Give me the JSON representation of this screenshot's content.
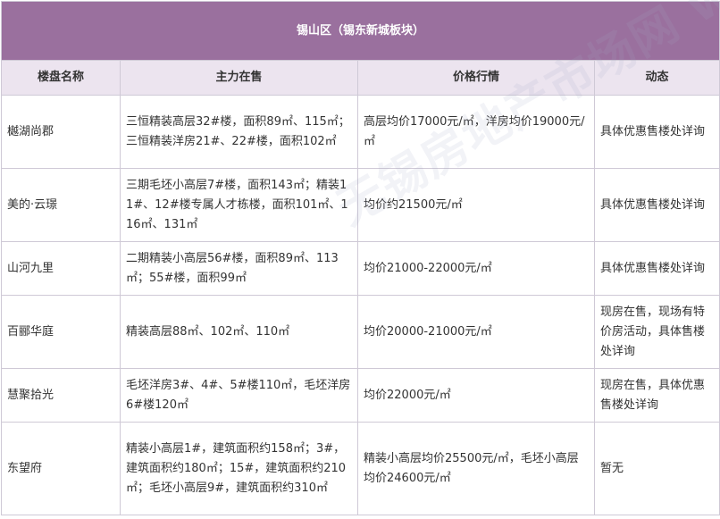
{
  "table": {
    "title": "锡山区（锡东新城板块）",
    "headers": [
      "楼盘名称",
      "主力在售",
      "价格行情",
      "动态"
    ],
    "rows": [
      {
        "name": "樾湖尚郡",
        "main_sale": "三恒精装高层32#楼，面积89㎡、115㎡；三恒精装洋房21#、22#楼，面积102㎡",
        "price": "高层均价17000元/㎡，洋房均价19000元/㎡",
        "status": "具体优惠售楼处详询"
      },
      {
        "name": "美的·云璟",
        "main_sale": "三期毛坯小高层7#楼，面积143㎡；精装11#、12#楼专属人才栋楼，面积101㎡、116㎡、131㎡",
        "price": "均价约21500元/㎡",
        "status": "具体优惠售楼处详询"
      },
      {
        "name": "山河九里",
        "main_sale": "二期精装小高层56#楼，面积89㎡、113㎡；55#楼，面积99㎡",
        "price": "均价21000-22000元/㎡",
        "status": "具体优惠售楼处详询"
      },
      {
        "name": "百郦华庭",
        "main_sale": "精装高层88㎡、102㎡、110㎡",
        "price": "均价20000-21000元/㎡",
        "status": "现房在售，现场有特价房活动，具体售楼处详询"
      },
      {
        "name": "慧聚拾光",
        "main_sale": "毛坯洋房3#、4#、5#楼110㎡，毛坯洋房6#楼120㎡",
        "price": "均价22000元/㎡",
        "status": "现房在售，具体优惠售楼处详询"
      },
      {
        "name": "东望府",
        "main_sale": "精装小高层1#，建筑面积约158㎡；3#，建筑面积约180㎡；15#，建筑面积约210㎡；毛坯小高层9#，建筑面积约310㎡",
        "price": "精装小高层均价25500元/㎡，毛坯小高层均价24600元/㎡",
        "status": "暂无"
      }
    ]
  },
  "watermark": "无锡房地产市场网 www.xhouse.com"
}
